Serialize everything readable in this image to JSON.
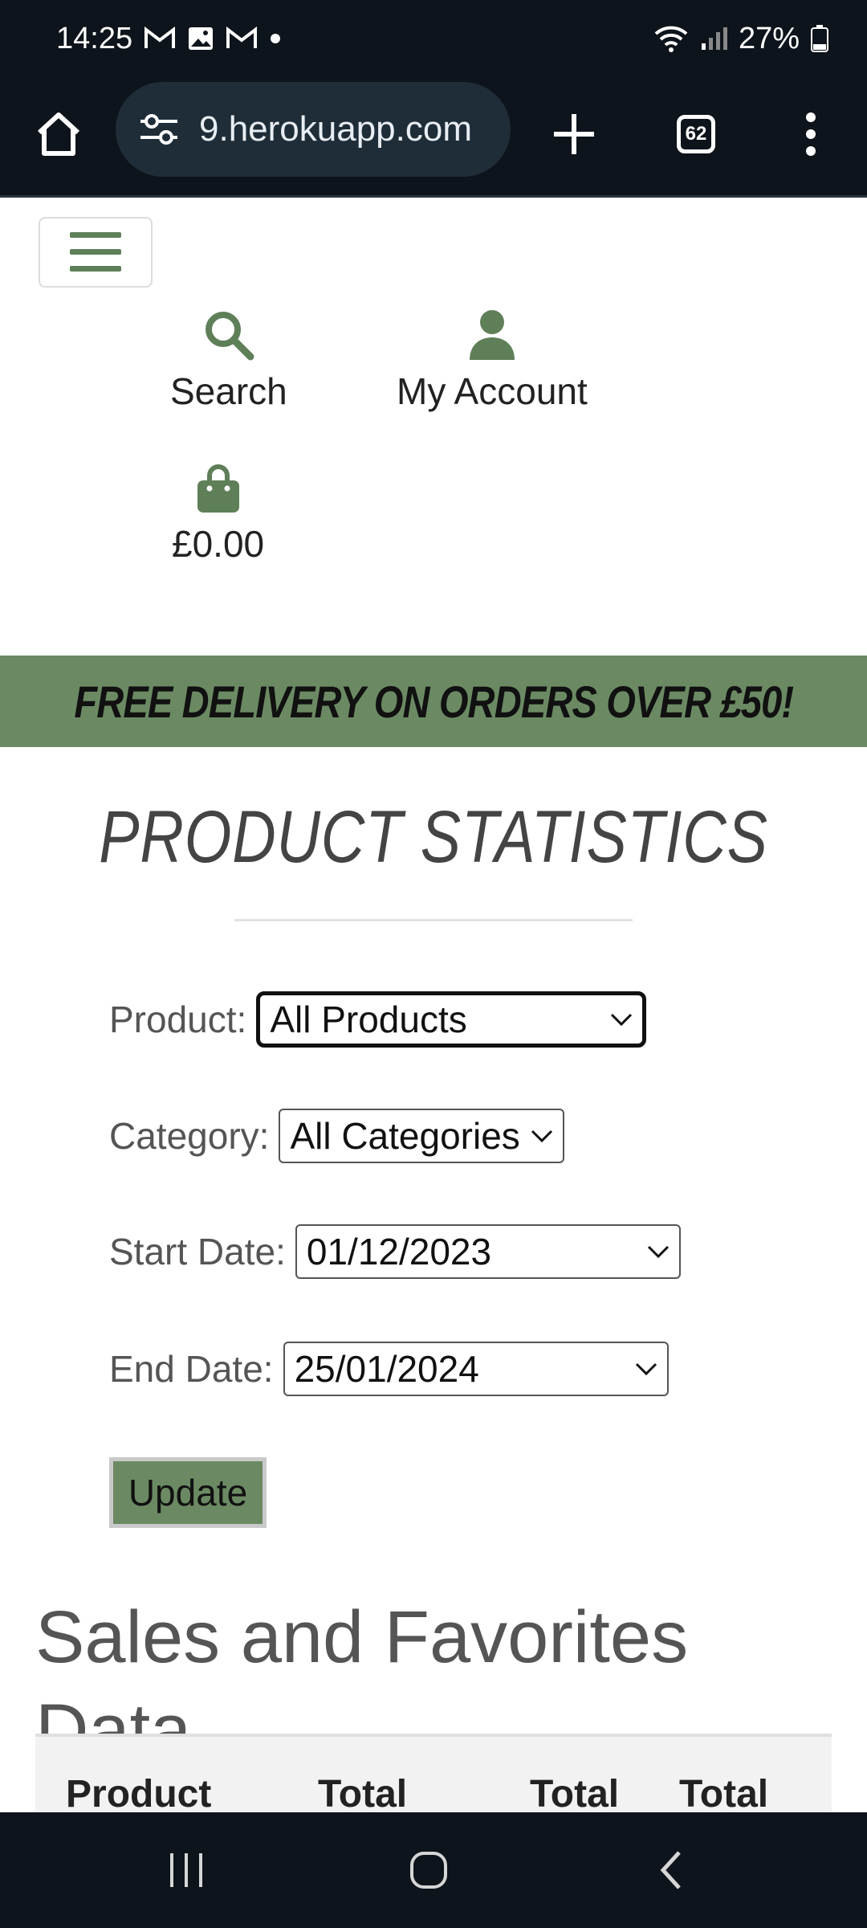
{
  "status_bar": {
    "time": "14:25",
    "battery": "27%"
  },
  "browser": {
    "url": "9.herokuapp.com",
    "tab_count": "62"
  },
  "nav": {
    "search_label": "Search",
    "account_label": "My Account",
    "bag_total": "£0.00"
  },
  "banner": {
    "text": "FREE DELIVERY ON ORDERS OVER £50!"
  },
  "page": {
    "title": "PRODUCT STATISTICS",
    "section_heading": "Sales and Favorites Data"
  },
  "form": {
    "product_label": "Product:",
    "product_value": "All Products",
    "category_label": "Category:",
    "category_value": "All Categories",
    "start_label": "Start Date:",
    "start_value": "01/12/2023",
    "end_label": "End Date:",
    "end_value": "25/01/2024",
    "update_label": "Update"
  },
  "table": {
    "headers": [
      "Product",
      "Total",
      "Total",
      "Total"
    ]
  },
  "colors": {
    "accent": "#6b8a63",
    "chrome": "#0e141b"
  }
}
